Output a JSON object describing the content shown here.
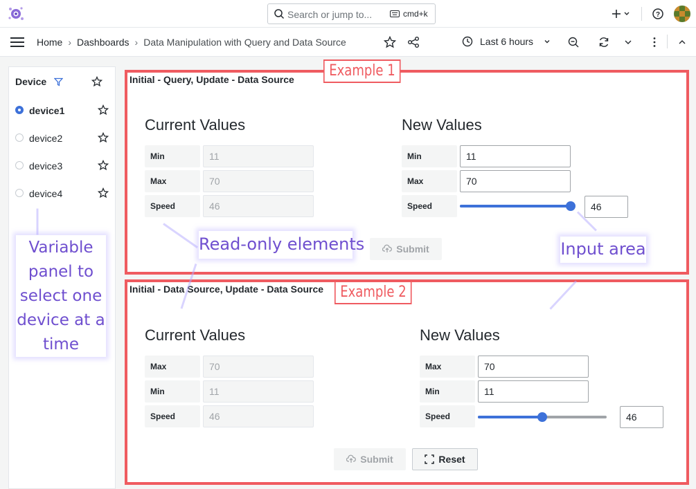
{
  "topbar": {
    "search_placeholder": "Search or jump to...",
    "search_shortcut": "cmd+k",
    "plus_label": "+"
  },
  "breadcrumb": {
    "home": "Home",
    "dashboards": "Dashboards",
    "current": "Data Manipulation with Query and Data Source"
  },
  "timepicker": {
    "label": "Last 6 hours"
  },
  "variable": {
    "title": "Device",
    "options": [
      {
        "label": "device1",
        "selected": true
      },
      {
        "label": "device2",
        "selected": false
      },
      {
        "label": "device3",
        "selected": false
      },
      {
        "label": "device4",
        "selected": false
      }
    ]
  },
  "panel1": {
    "title": "Initial - Query, Update - Data Source",
    "example_label": "Example 1",
    "current_heading": "Current Values",
    "new_heading": "New Values",
    "current": [
      {
        "label": "Min",
        "value": "11"
      },
      {
        "label": "Max",
        "value": "70"
      },
      {
        "label": "Speed",
        "value": "46"
      }
    ],
    "new": [
      {
        "label": "Min",
        "value": "11"
      },
      {
        "label": "Max",
        "value": "70"
      },
      {
        "label": "Speed",
        "value": "46"
      }
    ],
    "slider_fraction": 1.0,
    "submit_label": "Submit"
  },
  "panel2": {
    "title": "Initial - Data Source, Update - Data Source",
    "example_label": "Example 2",
    "current_heading": "Current Values",
    "new_heading": "New Values",
    "current": [
      {
        "label": "Max",
        "value": "70"
      },
      {
        "label": "Min",
        "value": "11"
      },
      {
        "label": "Speed",
        "value": "46"
      }
    ],
    "new": [
      {
        "label": "Max",
        "value": "70"
      },
      {
        "label": "Min",
        "value": "11"
      },
      {
        "label": "Speed",
        "value": "46"
      }
    ],
    "slider_fraction": 0.5,
    "submit_label": "Submit",
    "reset_label": "Reset"
  },
  "annotations": {
    "variable_panel": "Variable panel to select one device at a time",
    "read_only": "Read-only elements",
    "input_area": "Input area"
  },
  "colors": {
    "accent": "#3d71d9",
    "highlight": "#ef5b60",
    "annotation": "#6f4fcf"
  }
}
